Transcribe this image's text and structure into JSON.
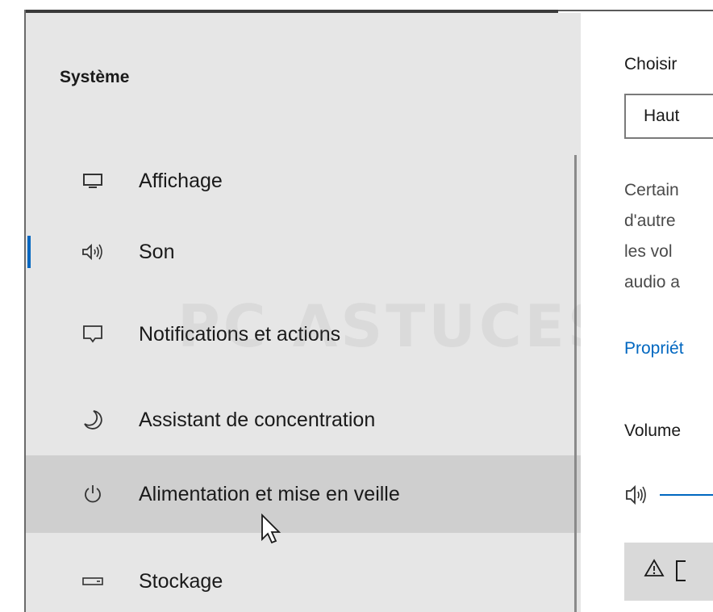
{
  "sidebar": {
    "title": "Système",
    "items": [
      {
        "label": "Affichage",
        "icon": "display-icon",
        "active": false,
        "hovered": false
      },
      {
        "label": "Son",
        "icon": "speaker-icon",
        "active": true,
        "hovered": false
      },
      {
        "label": "Notifications et actions",
        "icon": "notification-icon",
        "active": false,
        "hovered": false
      },
      {
        "label": "Assistant de concentration",
        "icon": "moon-icon",
        "active": false,
        "hovered": false
      },
      {
        "label": "Alimentation et mise en veille",
        "icon": "power-icon",
        "active": false,
        "hovered": true
      },
      {
        "label": "Stockage",
        "icon": "storage-icon",
        "active": false,
        "hovered": false
      }
    ]
  },
  "right_pane": {
    "choose_label": "Choisir",
    "dropdown_value": "Haut",
    "description_lines": [
      "Certain",
      "d'autre",
      "les vol",
      "audio a"
    ],
    "properties_link": "Propriét",
    "volume_label": "Volume",
    "warning_icon": "warning-icon"
  },
  "watermark": {
    "text": "PC ASTUCES"
  },
  "colors": {
    "accent": "#0067c0",
    "sidebar_bg": "#e6e6e6",
    "hover_bg": "#cfcfcf"
  }
}
